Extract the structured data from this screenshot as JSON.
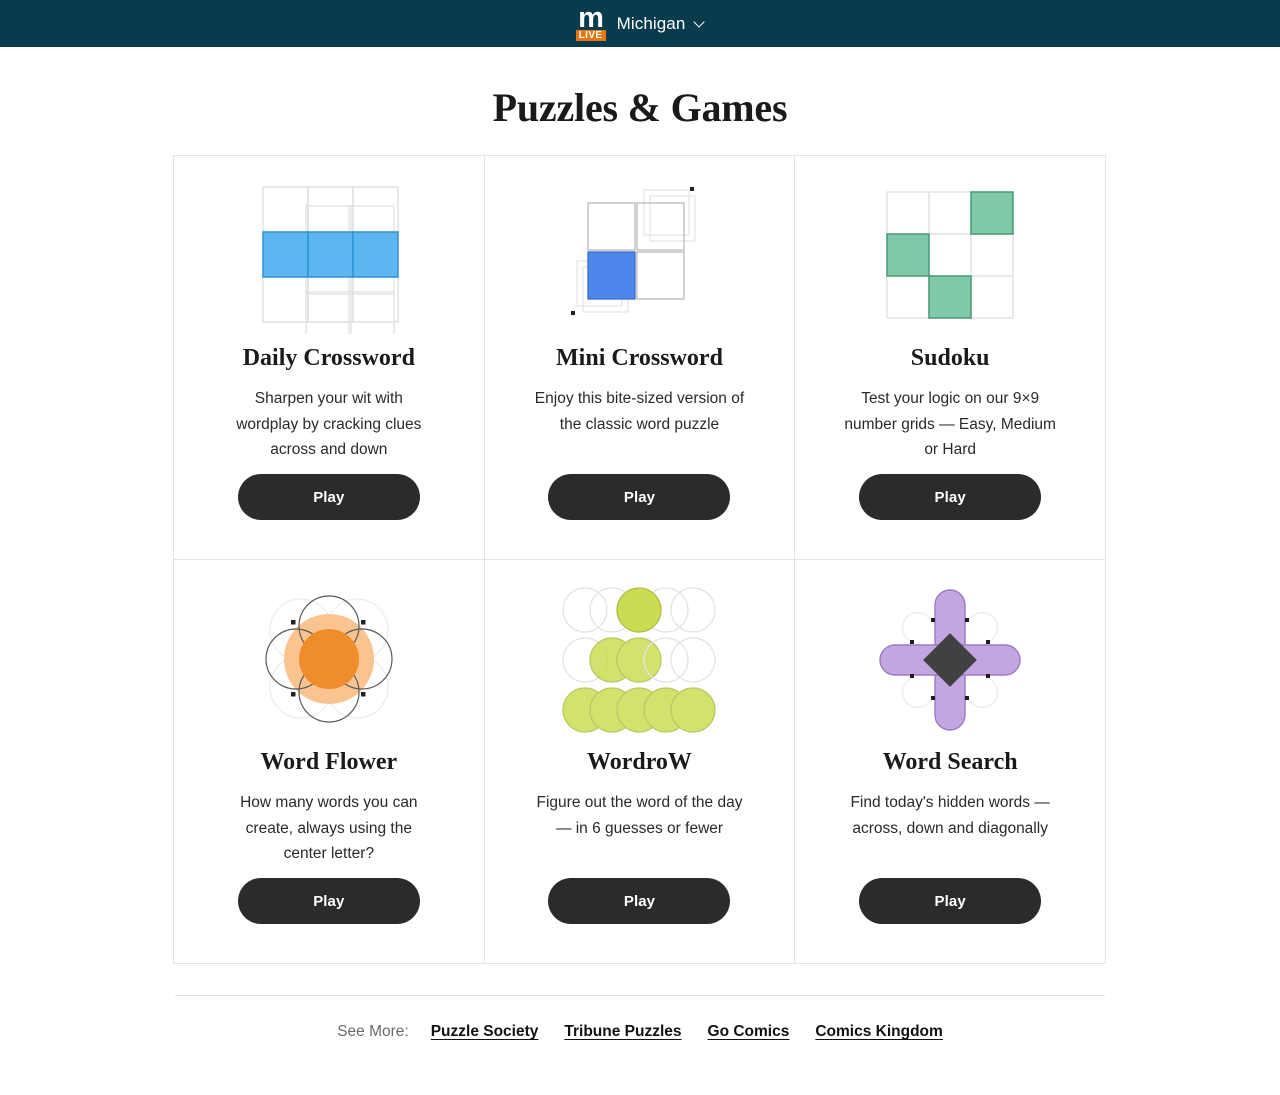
{
  "header": {
    "logo_icon": "mlive-logo-icon",
    "logo_letter": "m",
    "logo_tag": "LIVE",
    "brand_name": "Michigan",
    "chevron_icon": "chevron-down-icon",
    "background_color": "#083b4c",
    "accent_color": "#e8760f"
  },
  "page": {
    "title": "Puzzles & Games"
  },
  "cards": [
    {
      "icon": "crossword-grid-icon",
      "title": "Daily Crossword",
      "description": "Sharpen your wit with wordplay by cracking clues across and down",
      "button_label": "Play",
      "accent_color": "#4db2f0"
    },
    {
      "icon": "mini-crossword-icon",
      "title": "Mini Crossword",
      "description": "Enjoy this bite-sized version of the classic word puzzle",
      "button_label": "Play",
      "accent_color": "#4f86ec"
    },
    {
      "icon": "sudoku-grid-icon",
      "title": "Sudoku",
      "description": "Test your logic on our 9×9 number grids — Easy, Medium or Hard",
      "button_label": "Play",
      "accent_color": "#80c9a8"
    },
    {
      "icon": "word-flower-icon",
      "title": "Word Flower",
      "description": "How many words you can create, always using the center letter?",
      "button_label": "Play",
      "accent_color": "#ef8c2b"
    },
    {
      "icon": "wordrow-circles-icon",
      "title": "WordroW",
      "description": "Figure out the word of the day — in 6 guesses or fewer",
      "button_label": "Play",
      "accent_color": "#c7da45"
    },
    {
      "icon": "word-search-star-icon",
      "title": "Word Search",
      "description": "Find today's hidden words — across, down and diagonally",
      "button_label": "Play",
      "accent_color": "#c3a6e0"
    }
  ],
  "footer": {
    "see_more_label": "See More:",
    "links": [
      {
        "label": "Puzzle Society"
      },
      {
        "label": "Tribune Puzzles"
      },
      {
        "label": "Go Comics"
      },
      {
        "label": "Comics Kingdom"
      }
    ]
  }
}
